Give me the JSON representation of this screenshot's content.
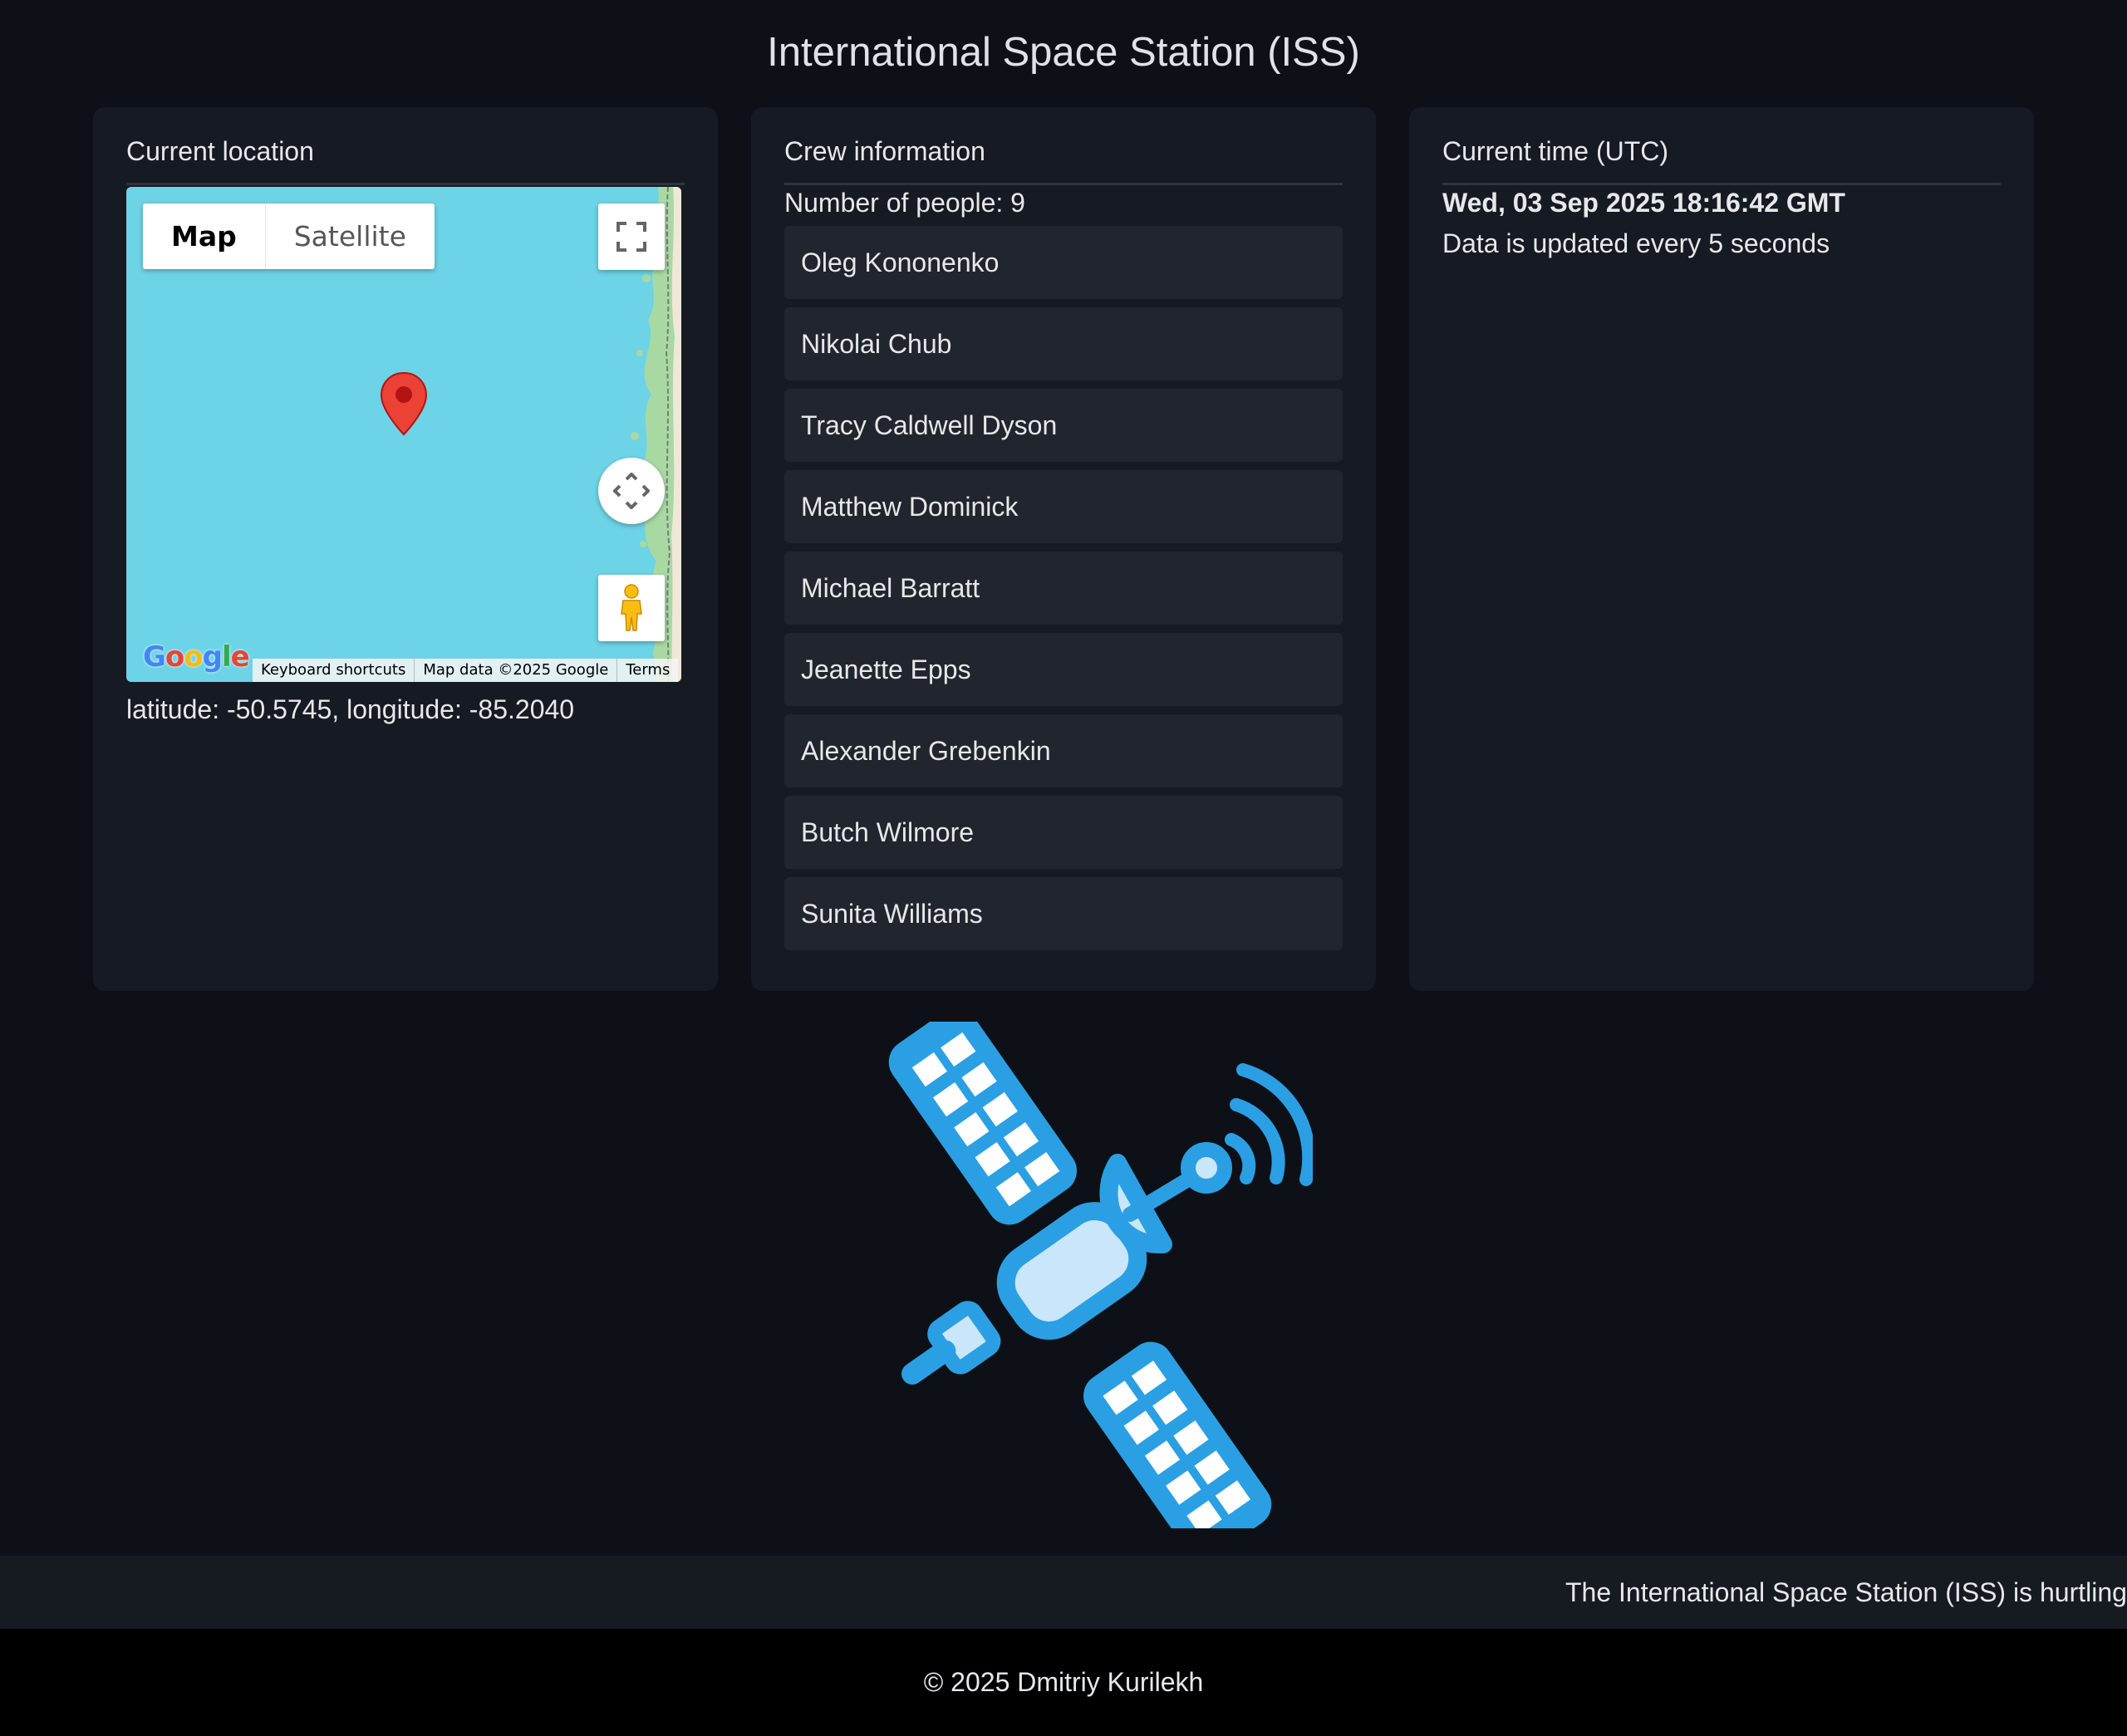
{
  "page": {
    "title": "International Space Station (ISS)"
  },
  "location": {
    "heading": "Current location",
    "coordinates": "latitude: -50.5745, longitude: -85.2040",
    "map": {
      "map_type_options": [
        "Map",
        "Satellite"
      ],
      "selected_map_type": "Map",
      "logo": "Google",
      "footer_links": [
        "Keyboard shortcuts",
        "Map data ©2025 Google",
        "Terms"
      ],
      "icons": [
        "fullscreen-icon",
        "pan-control-icon",
        "pegman-icon",
        "location-marker-icon"
      ],
      "water_color": "#6dd3e6",
      "marker_color": "#ea4335"
    }
  },
  "crew": {
    "heading": "Crew information",
    "count_text": "Number of people: 9",
    "members": [
      "Oleg Kononenko",
      "Nikolai Chub",
      "Tracy Caldwell Dyson",
      "Matthew Dominick",
      "Michael Barratt",
      "Jeanette Epps",
      "Alexander Grebenkin",
      "Butch Wilmore",
      "Sunita Williams"
    ]
  },
  "time": {
    "heading": "Current time (UTC)",
    "value": "Wed, 03 Sep 2025 18:16:42 GMT",
    "note": "Data is updated every 5 seconds"
  },
  "illustration": {
    "icon": "satellite-icon",
    "primary_color": "#2b9fe3",
    "secondary_color": "#c9e6fa"
  },
  "ticker": {
    "text": "The International Space Station (ISS) is hurtling"
  },
  "footer": {
    "text": "© 2025 Dmitriy Kurilekh"
  },
  "colors": {
    "background": "#0d1117",
    "card": "#161a22",
    "list_item": "#21252d",
    "text": "#e6e8eb"
  }
}
